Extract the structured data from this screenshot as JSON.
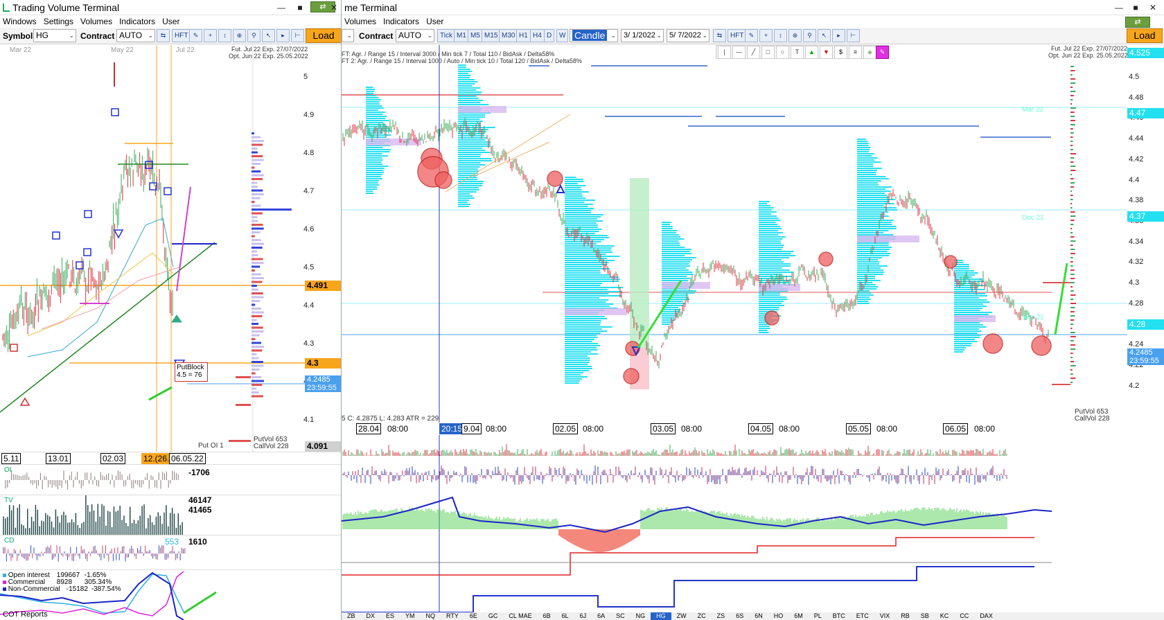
{
  "left": {
    "title": "Trading Volume Terminal",
    "menu": [
      "Windows",
      "Settings",
      "Volumes",
      "Indicators",
      "User"
    ],
    "toolbar": {
      "symbol_label": "Symbol",
      "symbol_value": "HG",
      "contract_label": "Contract",
      "contract_value": "AUTO",
      "hft": "HFT",
      "load": "Load"
    },
    "chart": {
      "header_line1": "Fut. Jul 22 Exp. 27/07/2022",
      "header_line2": "Opt. Jun 22 Exp. 25.05.2022",
      "top_months": [
        "Mar 22",
        "May 22",
        "Jul 22"
      ],
      "y_ticks": [
        "5",
        "4.9",
        "4.8",
        "4.7",
        "4.6",
        "4.5",
        "4.4",
        "4.3",
        "4.2",
        "4.1"
      ],
      "tag_491": "4.491",
      "tag_43": "4.3",
      "tag_price": "4.2485",
      "tag_time": "23:59:55",
      "tag_4091": "4.091",
      "putblock_line1": "PutBlock",
      "putblock_line2": "4.5 = 76",
      "putvol": "PutVol  653",
      "callvol": "CallVol  228",
      "put_oi": "Put   OI  1",
      "dates": [
        "5.11",
        "13.01",
        "02.03",
        "12.(26.",
        "06.05.22"
      ]
    },
    "oi_panel": {
      "label": "OI",
      "value": "-1706"
    },
    "tv_panel": {
      "label": "TV",
      "value1": "46147",
      "value2": "41465"
    },
    "cd_panel": {
      "label": "CD",
      "value_blue": "553",
      "value": "1610"
    },
    "cot": {
      "legend": [
        {
          "name": "Open interest",
          "value": "199667",
          "pct": "-1.65%",
          "color": "#2ab0e8"
        },
        {
          "name": "Commercial",
          "value": "8928",
          "pct": "305.34%",
          "color": "#e020e0"
        },
        {
          "name": "Non-Commercial",
          "value": "-15182",
          "pct": "-387.54%",
          "color": "#1a24c8"
        }
      ],
      "footer": "COT Reports"
    }
  },
  "right": {
    "title": "me Terminal",
    "menu": [
      "Volumes",
      "Indicators",
      "User"
    ],
    "toolbar": {
      "contract_label": "Contract",
      "contract_value": "AUTO",
      "timeframes": [
        "Tick",
        "M1",
        "M5",
        "M15",
        "M30",
        "H1",
        "H4",
        "D",
        "W"
      ],
      "chart_type": "Candle",
      "date_from": "3/ 1/2022",
      "date_to": "5/ 7/2022",
      "hft": "HFT",
      "load": "Load"
    },
    "chart": {
      "info1": "FT: Agr. / Range 15 / Interval 3000 / Min tick 7 / Total 110 / BidAsk / Delta58%",
      "info2": "FT 2: Agr. / Range 15 / Interval 1000 / Auto / Min tick 10 / Total 120 / BidAsk / Delta58%",
      "header_line1": "Fut. Jul 22 Exp. 27/07/2022",
      "header_line2": "Opt. Jun 22 Exp. 25.05.2022",
      "y_ticks": [
        "4.5",
        "4.48",
        "4.46",
        "4.44",
        "4.42",
        "4.4",
        "4.38",
        "4.36",
        "4.34",
        "4.32",
        "4.3",
        "4.28",
        "4.26",
        "4.24",
        "4.22",
        "4.2"
      ],
      "level_labels": [
        "Mar 22",
        "Dec 21",
        "Sep 21"
      ],
      "tag_top": "4.525",
      "tag_447": "4.47",
      "tag_437": "4.37",
      "tag_428": "4.28",
      "tag_price": "4.2485",
      "tag_time": "23:59:55",
      "ohlc": "5  C: 4.2875  L: 4.283  ATR = 229",
      "putvol": "PutVol  653",
      "callvol": "CallVol  228",
      "dates": [
        {
          "day": "28.04",
          "time": "08:00"
        },
        {
          "day": "20:15",
          "time": ""
        },
        {
          "day": "9.04",
          "time": "08:00"
        },
        {
          "day": "02.05",
          "time": "08:00"
        },
        {
          "day": "03.05",
          "time": "08:00"
        },
        {
          "day": "04.05",
          "time": "08:00"
        },
        {
          "day": "05.05",
          "time": "08:00"
        },
        {
          "day": "06.05",
          "time": "08:00"
        }
      ]
    },
    "bottom_symbols": [
      "ZB",
      "DX",
      "ES",
      "YM",
      "NQ",
      "RTY",
      "6E",
      "GC",
      "CL MAE",
      "6B",
      "6L",
      "6J",
      "6A",
      "SC",
      "NG",
      "HG",
      "ZW",
      "ZC",
      "ZS",
      "6S",
      "6N",
      "HO",
      "6M",
      "PL",
      "BTC",
      "ETC",
      "VIX",
      "RB",
      "SB",
      "KC",
      "CC",
      "DAX"
    ]
  },
  "colors": {
    "orange_tag": "#f7a51b",
    "blue_tag": "#4aa0ee",
    "cyan_profile": "#22e0f0",
    "lilac": "#d8b8f0",
    "candle_up": "#3aa95a",
    "candle_dn": "#e03040"
  }
}
